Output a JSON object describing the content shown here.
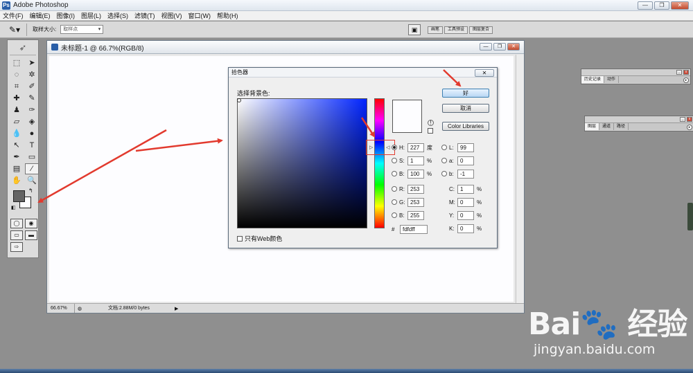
{
  "app": {
    "title": "Adobe Photoshop"
  },
  "menu": [
    "文件(F)",
    "编辑(E)",
    "图像(I)",
    "图层(L)",
    "选择(S)",
    "滤镜(T)",
    "视图(V)",
    "窗口(W)",
    "帮助(H)"
  ],
  "options": {
    "sample_size_label": "取样大小:",
    "sample_size_value": "取样点"
  },
  "palette_well": [
    "画笔",
    "工具预设",
    "图层复合"
  ],
  "document": {
    "title": "未标题-1 @ 66.7%(RGB/8)",
    "zoom": "66.67%",
    "doc_info": "文档:2.88M/0 bytes"
  },
  "color_picker": {
    "title": "拾色器",
    "prompt": "选择背景色:",
    "ok_label": "好",
    "cancel_label": "取消",
    "libraries_label": "Color Libraries",
    "web_only_label": "只有Web颜色",
    "H": "227",
    "H_unit": "度",
    "S": "1",
    "S_unit": "%",
    "B": "100",
    "B_unit": "%",
    "R": "253",
    "G": "253",
    "B2": "255",
    "L": "99",
    "a": "0",
    "b": "-1",
    "C": "1",
    "M": "0",
    "Y": "0",
    "K": "0",
    "pct": "%",
    "hex_label": "#",
    "hex": "fdfdff"
  },
  "panels": {
    "history": {
      "tabs": [
        "历史记录",
        "动作"
      ]
    },
    "layers": {
      "tabs": [
        "图层",
        "通道",
        "路径"
      ]
    }
  },
  "colors": {
    "foreground": "#646464",
    "background": "#fdfdff",
    "annotation": "#e23a2e"
  },
  "watermark": {
    "url": "jingyan.baidu.com"
  }
}
